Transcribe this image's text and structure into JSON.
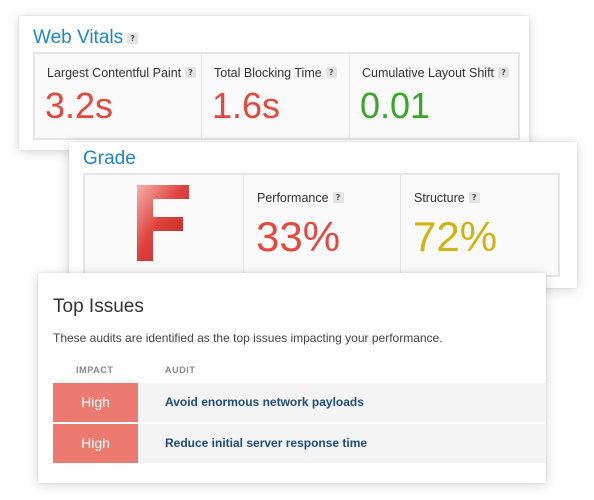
{
  "web_vitals": {
    "title": "Web Vitals",
    "help": "?",
    "metrics": [
      {
        "label": "Largest Contentful Paint",
        "value": "3.2s",
        "color": "#e5473f"
      },
      {
        "label": "Total Blocking Time",
        "value": "1.6s",
        "color": "#e5473f"
      },
      {
        "label": "Cumulative Layout Shift",
        "value": "0.01",
        "color": "#3aa52b"
      }
    ]
  },
  "grade": {
    "title": "Grade",
    "letter": "F",
    "letter_color": "#d9302b",
    "help": "?",
    "metrics": [
      {
        "label": "Performance",
        "value": "33%",
        "color": "#e5473f"
      },
      {
        "label": "Structure",
        "value": "72%",
        "color": "#cfb40f"
      }
    ]
  },
  "top_issues": {
    "title": "Top Issues",
    "description": "These audits are identified as the top issues impacting your performance.",
    "columns": {
      "impact": "IMPACT",
      "audit": "AUDIT"
    },
    "rows": [
      {
        "impact": "High",
        "audit": "Avoid enormous network payloads"
      },
      {
        "impact": "High",
        "audit": "Reduce initial server response time"
      }
    ],
    "impact_color": "#ec7a71",
    "link_color": "#1f4d79"
  }
}
